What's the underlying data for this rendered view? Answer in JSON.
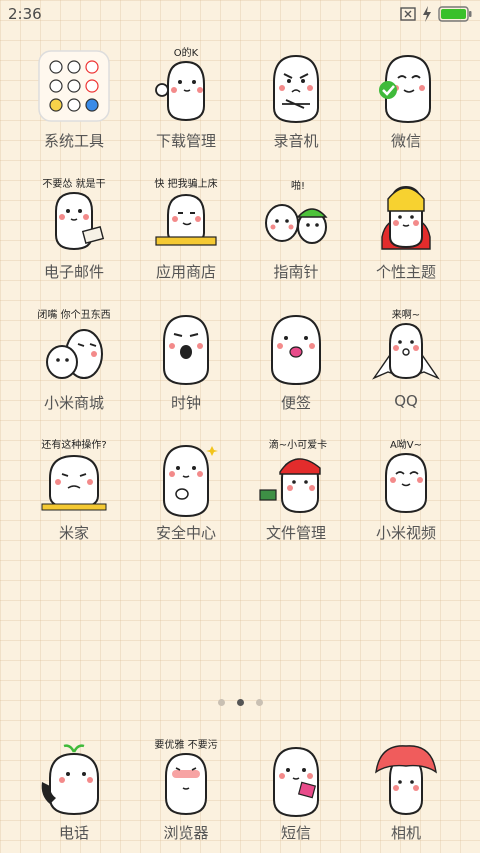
{
  "status_bar": {
    "time": "2:36"
  },
  "colors": {
    "background": "#fbf1df",
    "battery": "#39c02a",
    "label": "#555555"
  },
  "apps": [
    {
      "label": "系统工具",
      "icon": "folder-icon",
      "sticker_text": ""
    },
    {
      "label": "下载管理",
      "icon": "ok-hand-sticker-icon",
      "sticker_text": "O的K"
    },
    {
      "label": "录音机",
      "icon": "angry-crossed-arms-sticker-icon",
      "sticker_text": ""
    },
    {
      "label": "微信",
      "icon": "wechat-sticker-icon",
      "sticker_text": ""
    },
    {
      "label": "电子邮件",
      "icon": "letter-sticker-icon",
      "sticker_text": "不要怂 就是干"
    },
    {
      "label": "应用商店",
      "icon": "sneaky-bed-sticker-icon",
      "sticker_text": "快 把我骗上床"
    },
    {
      "label": "指南针",
      "icon": "two-buddies-sticker-icon",
      "sticker_text": "啪!"
    },
    {
      "label": "个性主题",
      "icon": "king-cape-sticker-icon",
      "sticker_text": ""
    },
    {
      "label": "小米商城",
      "icon": "hug-sticker-icon",
      "sticker_text": "闭嘴 你个丑东西"
    },
    {
      "label": "时钟",
      "icon": "shout-sticker-icon",
      "sticker_text": ""
    },
    {
      "label": "便签",
      "icon": "tongue-sticker-icon",
      "sticker_text": ""
    },
    {
      "label": "QQ",
      "icon": "flying-cape-sticker-icon",
      "sticker_text": "来啊~"
    },
    {
      "label": "米家",
      "icon": "helpless-sticker-icon",
      "sticker_text": "还有这种操作?"
    },
    {
      "label": "安全中心",
      "icon": "thumbs-up-sticker-icon",
      "sticker_text": ""
    },
    {
      "label": "文件管理",
      "icon": "red-cap-sticker-icon",
      "sticker_text": "滴~小可爱卡"
    },
    {
      "label": "小米视频",
      "icon": "smirk-sticker-icon",
      "sticker_text": "A呦V~"
    }
  ],
  "pager": {
    "page_count": 3,
    "active_index": 1
  },
  "dock": [
    {
      "label": "电话",
      "icon": "sprout-phone-sticker-icon",
      "sticker_text": ""
    },
    {
      "label": "浏览器",
      "icon": "shy-sticker-icon",
      "sticker_text": "要优雅 不要污"
    },
    {
      "label": "短信",
      "icon": "message-sticker-icon",
      "sticker_text": ""
    },
    {
      "label": "相机",
      "icon": "red-hood-sticker-icon",
      "sticker_text": ""
    }
  ]
}
